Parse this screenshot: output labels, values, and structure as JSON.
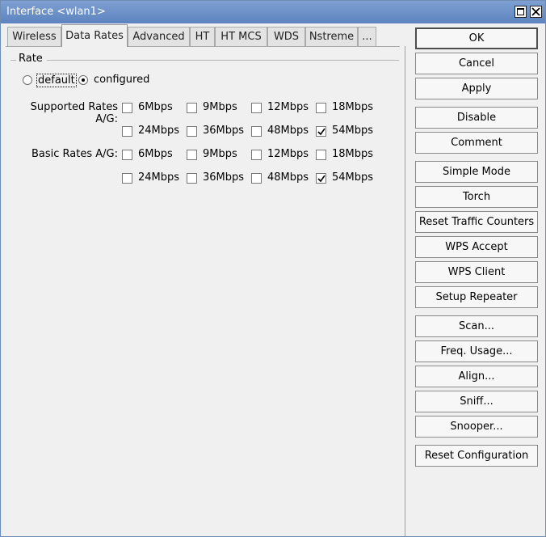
{
  "window": {
    "title": "Interface <wlan1>"
  },
  "tabs": [
    "Wireless",
    "Data Rates",
    "Advanced",
    "HT",
    "HT MCS",
    "WDS",
    "Nstreme",
    "..."
  ],
  "rate": {
    "legend": "Rate",
    "option_default": "default",
    "option_configured": "configured",
    "selected": "configured"
  },
  "supported": {
    "label": "Supported Rates A/G:",
    "rates": [
      "6Mbps",
      "9Mbps",
      "12Mbps",
      "18Mbps",
      "24Mbps",
      "36Mbps",
      "48Mbps",
      "54Mbps"
    ],
    "checked": [
      false,
      false,
      false,
      false,
      false,
      false,
      false,
      true
    ]
  },
  "basic": {
    "label": "Basic Rates A/G:",
    "rates": [
      "6Mbps",
      "9Mbps",
      "12Mbps",
      "18Mbps",
      "24Mbps",
      "36Mbps",
      "48Mbps",
      "54Mbps"
    ],
    "checked": [
      false,
      false,
      false,
      false,
      false,
      false,
      false,
      true
    ]
  },
  "buttons": [
    "OK",
    "Cancel",
    "Apply",
    "Disable",
    "Comment",
    "Simple Mode",
    "Torch",
    "Reset Traffic Counters",
    "WPS Accept",
    "WPS Client",
    "Setup Repeater",
    "Scan...",
    "Freq. Usage...",
    "Align...",
    "Sniff...",
    "Snooper...",
    "Reset Configuration"
  ]
}
